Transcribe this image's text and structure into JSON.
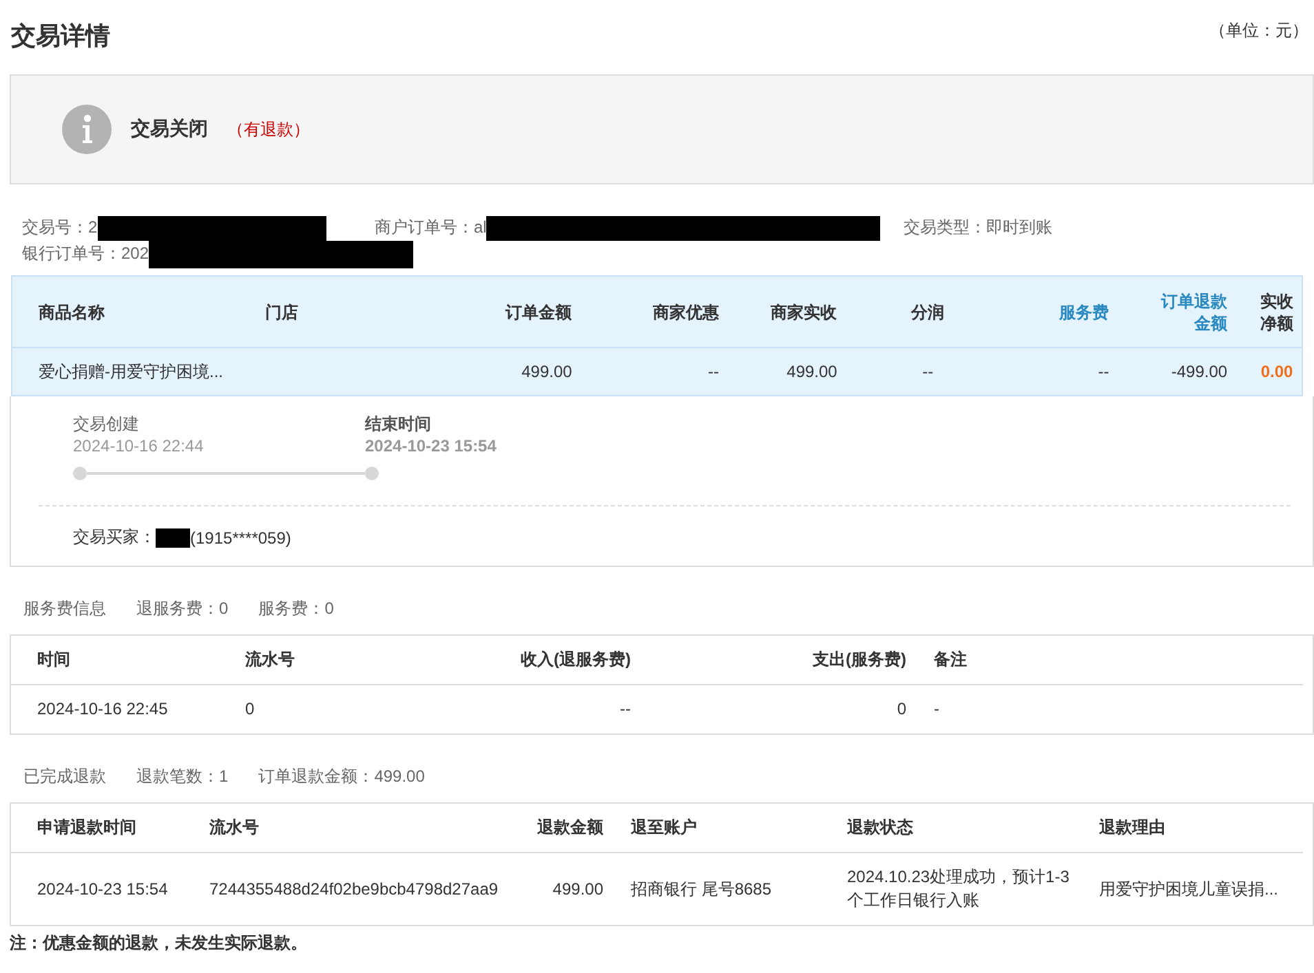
{
  "page": {
    "title": "交易详情",
    "unit": "（单位：元）"
  },
  "status": {
    "title": "交易关闭",
    "note": "（有退款）"
  },
  "info": {
    "trade_no": "交易号：2",
    "merchant_order_no": "商户订单号：al",
    "trade_type": "交易类型：即时到账",
    "bank_order_no": "银行订单号：202"
  },
  "order_table": {
    "columns": [
      {
        "label": "商品名称",
        "accent": false
      },
      {
        "label": "门店",
        "accent": false
      },
      {
        "label": "订单金额",
        "accent": false
      },
      {
        "label": "商家优惠",
        "accent": false
      },
      {
        "label": "商家实收",
        "accent": false
      },
      {
        "label": "分润",
        "accent": false
      },
      {
        "label": "服务费",
        "accent": true
      },
      {
        "label": "订单退款金额",
        "accent": true
      },
      {
        "label": "实收净额",
        "accent": false
      }
    ],
    "rows": [
      [
        "爱心捐赠-用爱守护困境...",
        "",
        "499.00",
        "--",
        "499.00",
        "--",
        "--",
        "-499.00",
        "0.00"
      ]
    ]
  },
  "timeline": {
    "steps": [
      {
        "label": "交易创建",
        "time": "2024-10-16 22:44",
        "current": false
      },
      {
        "label": "结束时间",
        "time": "2024-10-23 15:54",
        "current": true
      }
    ],
    "buyer_label": "交易买家：",
    "buyer_phone": "(1915****059)"
  },
  "service_fee": {
    "summary": [
      "服务费信息",
      "退服务费：0",
      "服务费：0"
    ],
    "columns": [
      "时间",
      "流水号",
      "收入(退服务费)",
      "支出(服务费)",
      "备注"
    ],
    "rows": [
      [
        "2024-10-16 22:45",
        "0",
        "--",
        "0",
        "-"
      ]
    ]
  },
  "refunds": {
    "summary": [
      "已完成退款",
      "退款笔数：1",
      "订单退款金额：499.00"
    ],
    "columns": [
      "申请退款时间",
      "流水号",
      "退款金额",
      "退至账户",
      "退款状态",
      "退款理由"
    ],
    "rows": [
      [
        "2024-10-23 15:54",
        "7244355488d24f02be9bcb4798d27aa9",
        "499.00",
        "招商银行 尾号8685",
        "2024.10.23处理成功，预计1-3个工作日银行入账",
        "用爱守护困境儿童误捐..."
      ]
    ]
  },
  "footnote": "注：优惠金额的退款，未发生实际退款。"
}
